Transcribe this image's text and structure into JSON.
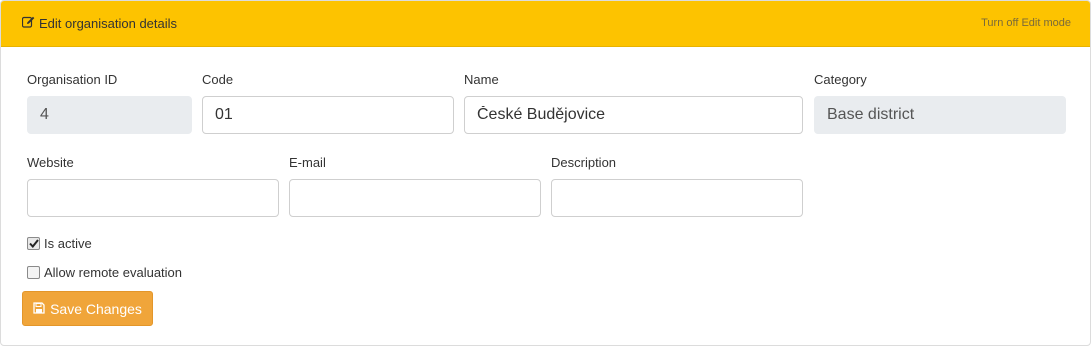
{
  "header": {
    "title": "Edit organisation details",
    "turn_off_edit_label": "Turn off Edit mode"
  },
  "fields": {
    "org_id": {
      "label": "Organisation ID",
      "value": "4"
    },
    "code": {
      "label": "Code",
      "value": "01"
    },
    "name": {
      "label": "Name",
      "value": "České Budějovice"
    },
    "category": {
      "label": "Category",
      "value": "Base district"
    },
    "website": {
      "label": "Website",
      "value": ""
    },
    "email": {
      "label": "E-mail",
      "value": ""
    },
    "description": {
      "label": "Description",
      "value": ""
    }
  },
  "checkboxes": {
    "is_active": {
      "label": "Is active",
      "checked": true
    },
    "allow_remote": {
      "label": "Allow remote evaluation",
      "checked": false
    }
  },
  "save_button": {
    "label": "Save Changes"
  },
  "colors": {
    "header_bg": "#fdc300",
    "button_bg": "#f0a53a",
    "readonly_bg": "#e9ecef"
  }
}
